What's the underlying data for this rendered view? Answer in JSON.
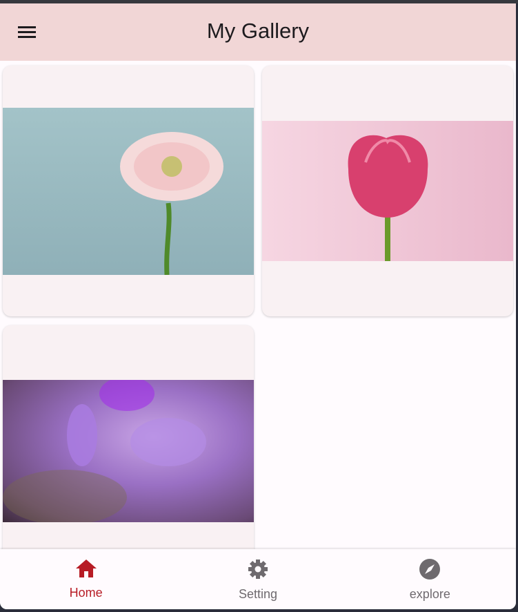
{
  "appbar": {
    "title": "My Gallery",
    "menu_icon": "hamburger-menu-icon"
  },
  "gallery": [
    {
      "subject": "pink gerbera daisy"
    },
    {
      "subject": "pink tulip"
    },
    {
      "subject": "purple crocus"
    }
  ],
  "nav": {
    "items": [
      {
        "label": "Home",
        "icon": "home-icon",
        "active": true
      },
      {
        "label": "Setting",
        "icon": "gear-icon"
      },
      {
        "label": "explore",
        "icon": "compass-icon"
      }
    ]
  },
  "colors": {
    "appbar": "#f1d6d6",
    "active": "#b71c25",
    "inactive": "#6e6a6e"
  }
}
